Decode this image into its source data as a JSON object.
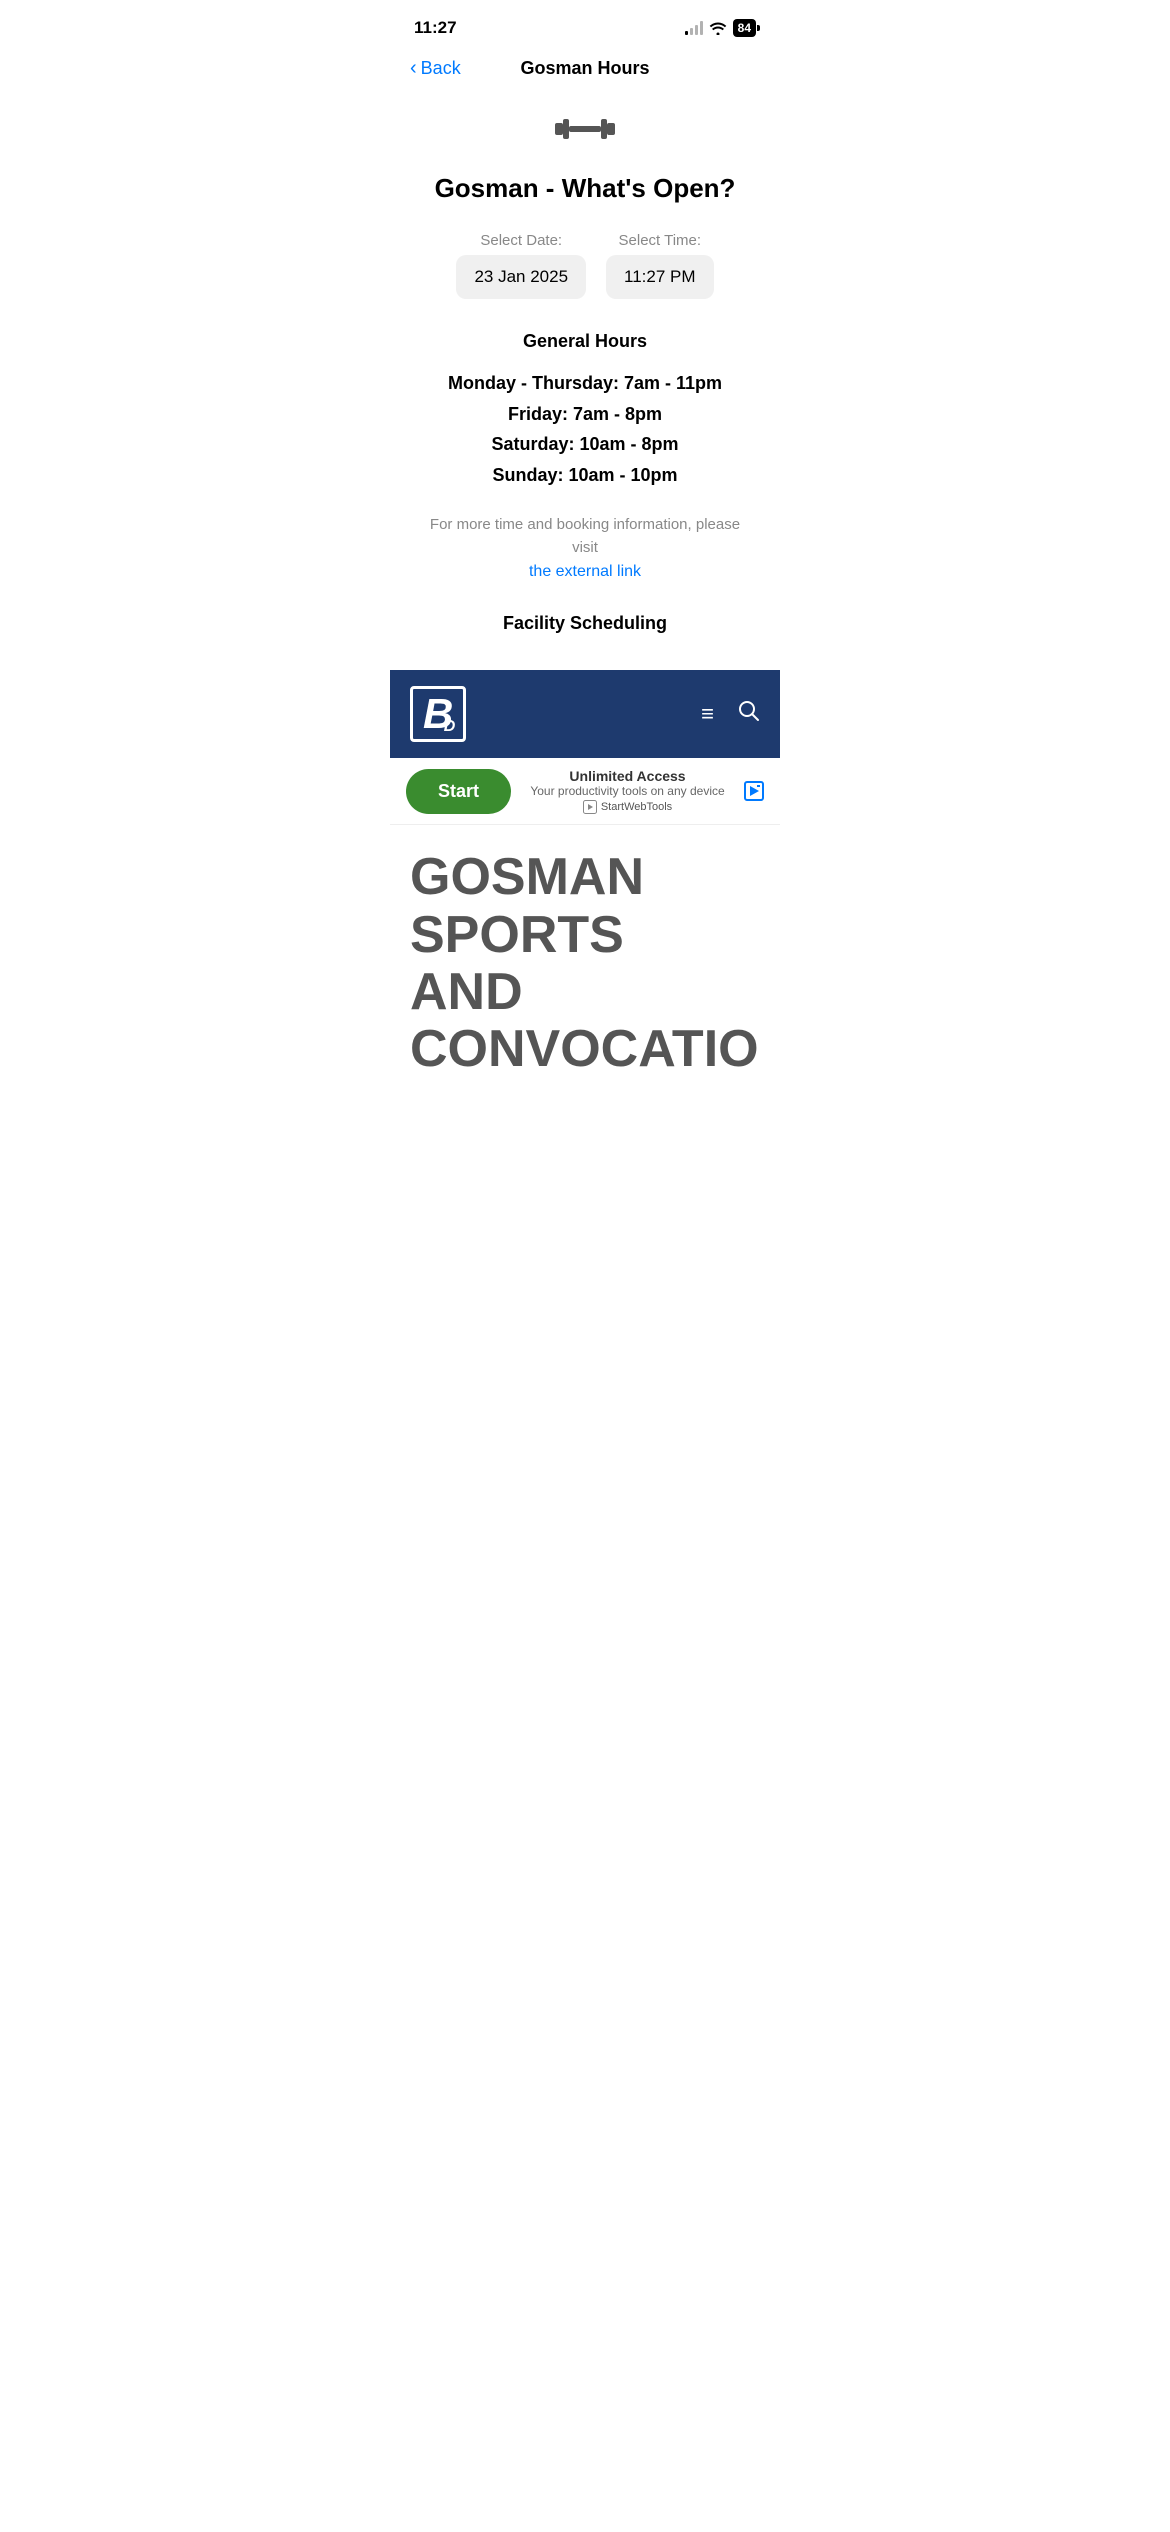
{
  "statusBar": {
    "time": "11:27",
    "battery": "84"
  },
  "navBar": {
    "backLabel": "Back",
    "title": "Gosman Hours"
  },
  "page": {
    "icon": "🏋",
    "heading": "Gosman - What's Open?",
    "datePicker": {
      "label": "Select Date:",
      "value": "23 Jan 2025"
    },
    "timePicker": {
      "label": "Select Time:",
      "value": "11:27 PM"
    },
    "generalHoursTitle": "General Hours",
    "hours": [
      "Monday - Thursday: 7am - 11pm",
      "Friday: 7am - 8pm",
      "Saturday: 10am - 8pm",
      "Sunday: 10am - 10pm"
    ],
    "moreInfoText": "For more time and booking information, please visit",
    "externalLinkText": "the external link",
    "facilityTitle": "Facility Scheduling"
  },
  "embeddedWeb": {
    "logoLetters": "B",
    "logoSub": "D",
    "hamburgerLabel": "≡",
    "searchLabel": "🔍",
    "adStartLabel": "Start",
    "adTitle": "Unlimited Access",
    "adSubtitle": "Your productivity tools on any device",
    "adLogoText": "StartWebTools",
    "bigHeadingLine1": "GOSMAN SPORTS",
    "bigHeadingLine2": "AND",
    "bigHeadingLine3": "CONVOCATION"
  }
}
